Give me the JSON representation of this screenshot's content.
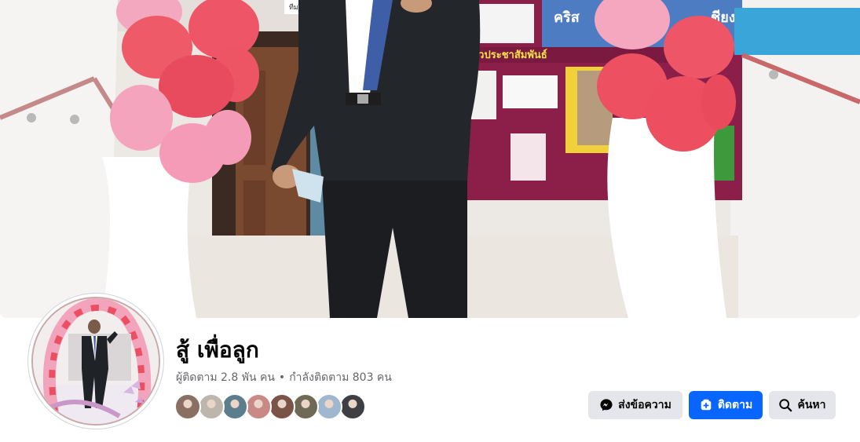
{
  "cover": {
    "board_title": "ข่าวประชาสัมพันธ์",
    "banner_left": "คริส",
    "banner_right": "ชียงใหม่",
    "sign": "ทีมงี/ Tim"
  },
  "profile": {
    "name": "สู้ เพื่อลูก",
    "followers_text": "ผู้ติดตาม 2.8 พัน คน",
    "separator": "•",
    "following_text": "กำลังติดตาม 803 คน"
  },
  "followers_preview": [
    {
      "name": "follower-1",
      "color": "#8a6f63"
    },
    {
      "name": "follower-2",
      "color": "#bdb6ac"
    },
    {
      "name": "follower-3",
      "color": "#5b7d8c"
    },
    {
      "name": "follower-4",
      "color": "#c98a86"
    },
    {
      "name": "follower-5",
      "color": "#7a5446"
    },
    {
      "name": "follower-6",
      "color": "#6e6a56"
    },
    {
      "name": "follower-7",
      "color": "#9fb8cf"
    },
    {
      "name": "follower-8",
      "color": "#3d3f42"
    }
  ],
  "actions": {
    "message_label": "ส่งข้อความ",
    "follow_label": "ติดตาม",
    "search_label": "ค้นหา"
  },
  "colors": {
    "primary": "#0866ff",
    "secondary_btn": "#e4e6eb",
    "text_primary": "#050505",
    "text_secondary": "#65676b"
  },
  "icons": {
    "message": "messenger-icon",
    "follow": "follow-icon",
    "search": "search-icon"
  }
}
